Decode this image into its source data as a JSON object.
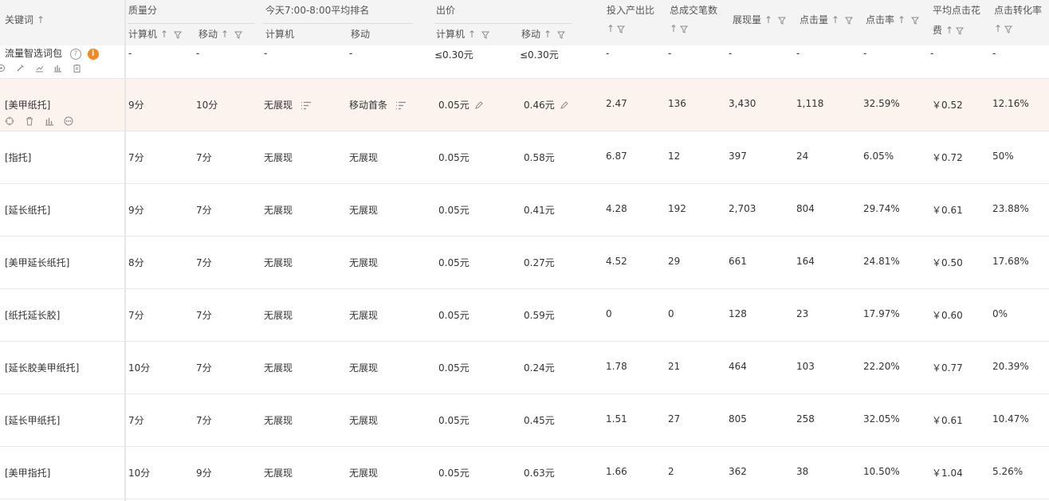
{
  "header": {
    "keyword": "关键词",
    "quality": "质量分",
    "quality_pc": "计算机",
    "quality_mobile": "移动",
    "rank_group": "今天7:00-8:00平均排名",
    "rank_pc": "计算机",
    "rank_mobile": "移动",
    "bid_group": "出价",
    "bid_pc": "计算机",
    "bid_mobile": "移动",
    "roi_line1": "投入产出比",
    "orders": "总成交笔数",
    "impressions": "展现量",
    "clicks": "点击量",
    "ctr": "点击率",
    "cpc_line1": "平均点击花",
    "cpc_line2": "费",
    "cvr": "点击转化率"
  },
  "package_row": {
    "name": "流量智选词包",
    "q_pc": "-",
    "q_mobile": "-",
    "r_pc": "-",
    "r_mobile": "-",
    "bid_pc": "≤0.30元",
    "bid_mobile": "≤0.30元",
    "roi": "-",
    "orders": "-",
    "impressions": "-",
    "clicks": "-",
    "ctr": "-",
    "cpc": "-",
    "cvr": "-"
  },
  "rows": [
    {
      "keyword": "[美甲纸托]",
      "q_pc": "9分",
      "q_mobile": "10分",
      "r_pc": "无展现",
      "r_mobile": "移动首条",
      "bid_pc": "0.05元",
      "bid_mobile": "0.46元",
      "roi": "2.47",
      "orders": "136",
      "impressions": "3,430",
      "clicks": "1,118",
      "ctr": "32.59%",
      "cpc": "￥0.52",
      "cvr": "12.16%"
    },
    {
      "keyword": "[指托]",
      "q_pc": "7分",
      "q_mobile": "7分",
      "r_pc": "无展现",
      "r_mobile": "无展现",
      "bid_pc": "0.05元",
      "bid_mobile": "0.58元",
      "roi": "6.87",
      "orders": "12",
      "impressions": "397",
      "clicks": "24",
      "ctr": "6.05%",
      "cpc": "￥0.72",
      "cvr": "50%"
    },
    {
      "keyword": "[延长纸托]",
      "q_pc": "9分",
      "q_mobile": "7分",
      "r_pc": "无展现",
      "r_mobile": "无展现",
      "bid_pc": "0.05元",
      "bid_mobile": "0.41元",
      "roi": "4.28",
      "orders": "192",
      "impressions": "2,703",
      "clicks": "804",
      "ctr": "29.74%",
      "cpc": "￥0.61",
      "cvr": "23.88%"
    },
    {
      "keyword": "[美甲延长纸托]",
      "q_pc": "8分",
      "q_mobile": "7分",
      "r_pc": "无展现",
      "r_mobile": "无展现",
      "bid_pc": "0.05元",
      "bid_mobile": "0.27元",
      "roi": "4.52",
      "orders": "29",
      "impressions": "661",
      "clicks": "164",
      "ctr": "24.81%",
      "cpc": "￥0.50",
      "cvr": "17.68%"
    },
    {
      "keyword": "[纸托延长胶]",
      "q_pc": "7分",
      "q_mobile": "7分",
      "r_pc": "无展现",
      "r_mobile": "无展现",
      "bid_pc": "0.05元",
      "bid_mobile": "0.59元",
      "roi": "0",
      "orders": "0",
      "impressions": "128",
      "clicks": "23",
      "ctr": "17.97%",
      "cpc": "￥0.60",
      "cvr": "0%"
    },
    {
      "keyword": "[延长胶美甲纸托]",
      "q_pc": "10分",
      "q_mobile": "7分",
      "r_pc": "无展现",
      "r_mobile": "无展现",
      "bid_pc": "0.05元",
      "bid_mobile": "0.24元",
      "roi": "1.78",
      "orders": "21",
      "impressions": "464",
      "clicks": "103",
      "ctr": "22.20%",
      "cpc": "￥0.77",
      "cvr": "20.39%"
    },
    {
      "keyword": "[延长甲纸托]",
      "q_pc": "7分",
      "q_mobile": "7分",
      "r_pc": "无展现",
      "r_mobile": "无展现",
      "bid_pc": "0.05元",
      "bid_mobile": "0.45元",
      "roi": "1.51",
      "orders": "27",
      "impressions": "805",
      "clicks": "258",
      "ctr": "32.05%",
      "cpc": "￥0.61",
      "cvr": "10.47%"
    },
    {
      "keyword": "[美甲指托]",
      "q_pc": "10分",
      "q_mobile": "9分",
      "r_pc": "无展现",
      "r_mobile": "无展现",
      "bid_pc": "0.05元",
      "bid_mobile": "0.63元",
      "roi": "1.66",
      "orders": "2",
      "impressions": "362",
      "clicks": "38",
      "ctr": "10.50%",
      "cpc": "￥1.04",
      "cvr": "5.26%"
    }
  ]
}
